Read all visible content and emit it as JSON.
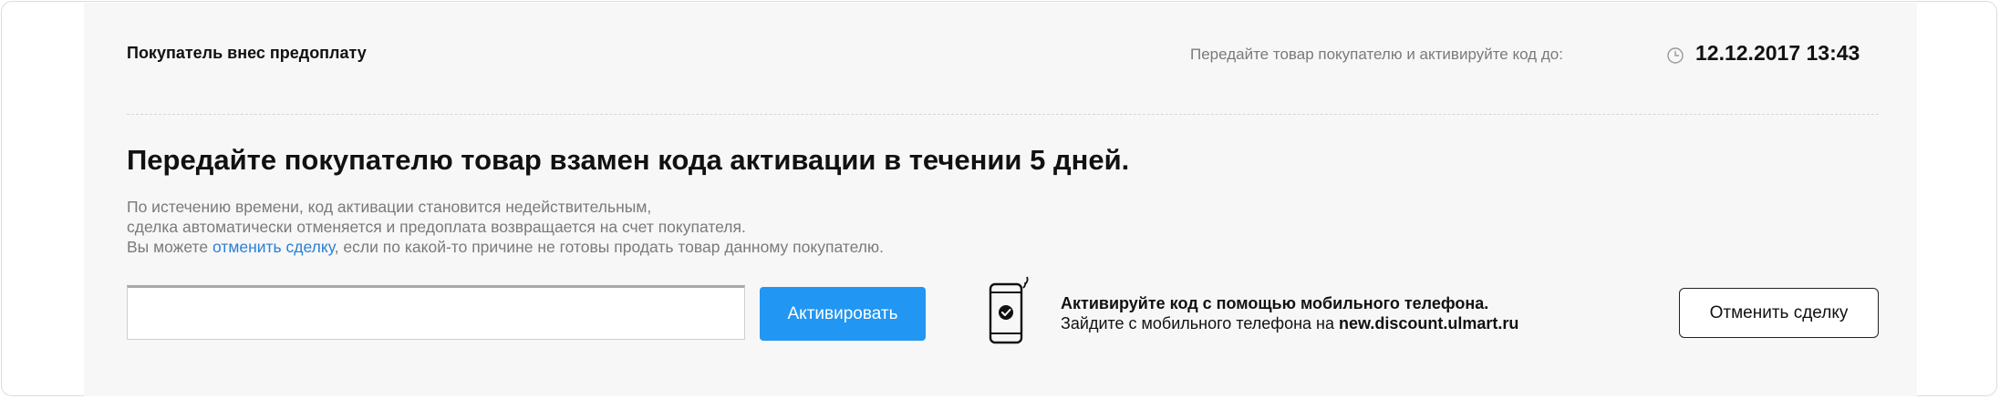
{
  "header": {
    "status": "Покупатель внес предоплату",
    "deadline_label": "Передайте товар покупателю и активируйте код до:",
    "deadline_value": "12.12.2017 13:43"
  },
  "main": {
    "heading": "Передайте покупателю товар взамен кода активации в течении 5 дней.",
    "desc_line1": "По истечению времени, код активации становится недействительным,",
    "desc_line2": "сделка автоматически отменяется и предоплата возвращается на счет покупателя.",
    "desc_line3_prefix": "Вы можете ",
    "cancel_link": "отменить сделку",
    "desc_line3_suffix": ", если по какой-то причине не готовы продать товар данному покупателю."
  },
  "activation": {
    "input_value": "",
    "input_placeholder": "",
    "activate_label": "Активировать"
  },
  "mobile": {
    "title": "Активируйте код с помощью мобильного телефона.",
    "text_prefix": "Зайдите с мобильного телефона на ",
    "url": "new.discount.ulmart.ru"
  },
  "actions": {
    "cancel_deal_label": "Отменить сделку"
  },
  "colors": {
    "accent": "#2196f3",
    "link": "#2a7fd4",
    "panel_bg": "#f7f7f7",
    "muted_text": "#7a7a7a"
  },
  "icons": {
    "clock": "clock-icon",
    "phone": "mobile-phone-icon",
    "check": "check-icon"
  }
}
